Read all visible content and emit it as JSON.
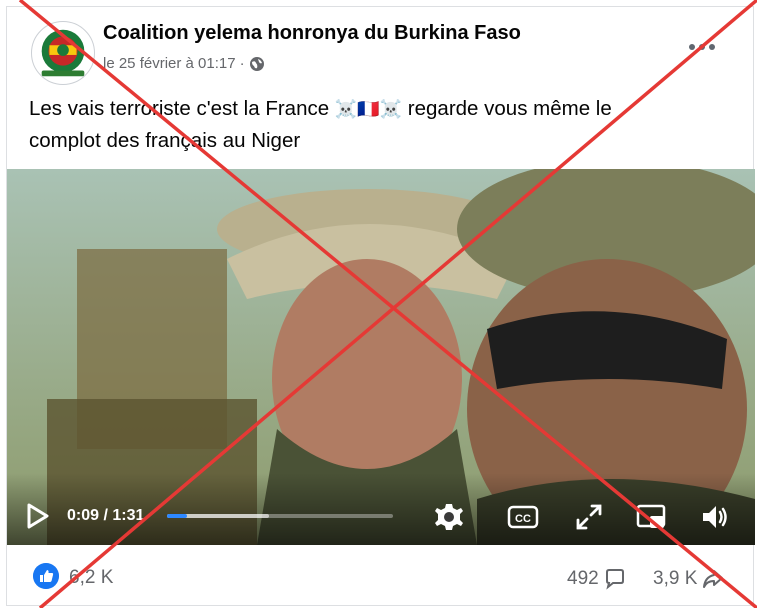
{
  "post": {
    "page_name": "Coalition yelema honronya du Burkina Faso",
    "timestamp": "le 25 février à 01:17",
    "separator": "·",
    "audience_icon": "globe-icon",
    "caption_line1_part1": "Les vais terroriste c'est la France ",
    "caption_emojis": "☠️🇫🇷☠️",
    "caption_line1_part2": " regarde vous même le",
    "caption_line2": "complot des français au Niger",
    "avatar_icon": "page-logo"
  },
  "video": {
    "current_time": "0:09",
    "time_separator": " / ",
    "duration": "1:31",
    "progress_fraction": 0.09,
    "buffered_fraction": 0.45,
    "controls": [
      "play-icon",
      "gear-icon",
      "cc-icon",
      "expand-icon",
      "pip-icon",
      "volume-icon"
    ],
    "cc_label": "CC"
  },
  "engagement": {
    "reactions": "6,2 K",
    "comments": "492",
    "shares": "3,9 K"
  },
  "overlay": {
    "cross_color": "#e53935"
  },
  "colors": {
    "accent": "#1877f2",
    "secondary_text": "#65676b"
  }
}
